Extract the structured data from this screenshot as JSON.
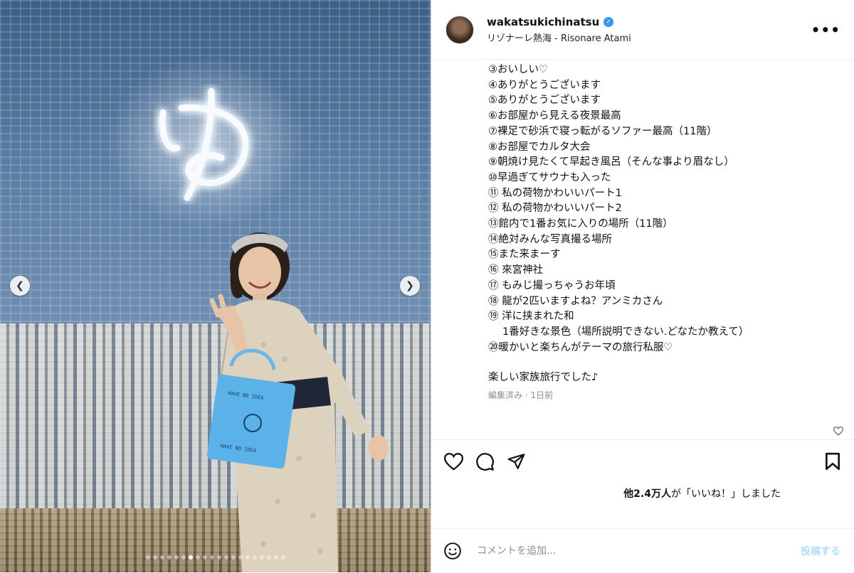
{
  "post": {
    "username": "wakatsukichinatsu",
    "location": "リゾナーレ熱海 - Risonare Atami",
    "more_icon": "more-horizontal-icon"
  },
  "media": {
    "carousel_total": 20,
    "carousel_active": 7,
    "neon_sign": "ゆ"
  },
  "caption": {
    "lines": [
      "③おいしい♡",
      "④ありがとうございます",
      "⑤ありがとうございます",
      "⑥お部屋から見える夜景最高",
      "⑦裸足で砂浜で寝っ転がるソファー最高（11階）",
      "⑧お部屋でカルタ大会",
      "⑨朝焼け見たくて早起き風呂（そんな事より眉なし）",
      "⑩早過ぎてサウナも入った",
      "⑪ 私の荷物かわいいパート1",
      "⑫ 私の荷物かわいいパート2",
      "⑬館内で1番お気に入りの場所（11階）",
      "⑭絶対みんな写真撮る場所",
      "⑮また来まーす",
      "⑯ 來宮神社",
      "⑰ もみじ撮っちゃうお年頃",
      "⑱ 龍が2匹いますよね？アンミカさん",
      "⑲ 洋に挟まれた和",
      "1番好きな景色（場所説明できない.どなたか教えて）",
      "⑳暖かいと楽ちんがテーマの旅行私服♡"
    ],
    "closing": "楽しい家族旅行でした♪",
    "meta": "編集済み · 1日前"
  },
  "likes": {
    "count": "他2.4万人",
    "suffix": "が「いいね！」しました"
  },
  "comment": {
    "placeholder": "コメントを追加...",
    "post_label": "投稿する"
  },
  "colors": {
    "verified": "#3897f0",
    "post_button": "#b2dffc",
    "meta": "#8e8e8e"
  }
}
